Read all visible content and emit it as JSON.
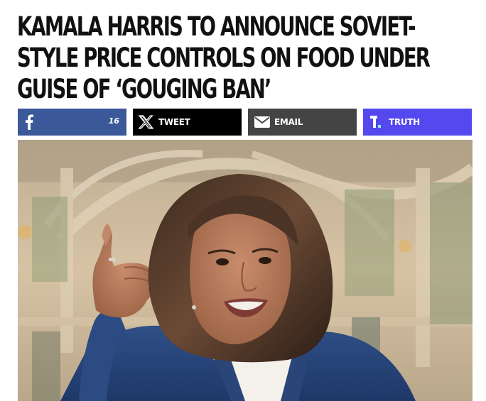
{
  "article": {
    "headline_lines": [
      "KAMALA HARRIS TO ANNOUNCE SOVIET-",
      "STYLE PRICE CONTROLS ON FOOD UNDER",
      "GUISE OF ‘GOUGING BAN’"
    ]
  },
  "share": {
    "facebook": {
      "icon": "facebook-icon",
      "count": "16",
      "color": "#3b5998"
    },
    "tweet": {
      "icon": "x-icon",
      "label": "TWEET",
      "color": "#000000"
    },
    "email": {
      "icon": "envelope-icon",
      "label": "EMAIL",
      "color": "#444444"
    },
    "truth": {
      "icon": "truth-social-icon",
      "label": "TRUTH",
      "color": "#5448ee"
    }
  }
}
